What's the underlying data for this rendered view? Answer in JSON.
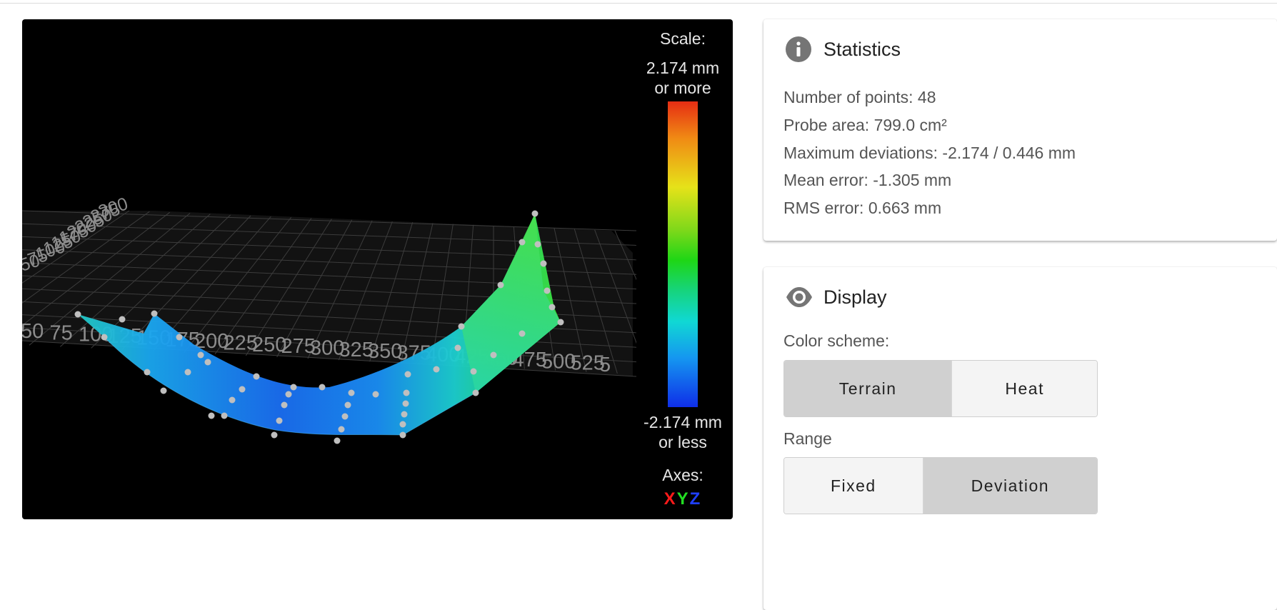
{
  "viewer": {
    "scale_title": "Scale:",
    "scale_max_line1": "2.174 mm",
    "scale_max_line2": "or more",
    "scale_min_line1": "-2.174 mm",
    "scale_min_line2": "or less",
    "axes_title": "Axes:",
    "axis_x": "X",
    "axis_y": "Y",
    "axis_z": "Z",
    "grid_x_labels": [
      "50",
      "75",
      "100",
      "125",
      "150",
      "175",
      "200",
      "225",
      "250",
      "275",
      "300",
      "325",
      "350",
      "375",
      "400",
      "425",
      "450",
      "475",
      "500",
      "525",
      "5"
    ],
    "grid_y_labels": [
      "300",
      "275",
      "250",
      "225",
      "200",
      "175",
      "150",
      "125",
      "100",
      "75",
      "50"
    ],
    "colors": {
      "max": "#e62d13",
      "mid": "#1ed616",
      "min": "#0f2ee8",
      "background": "#000000"
    }
  },
  "statistics": {
    "title": "Statistics",
    "icon": "info-icon",
    "points": "Number of points: 48",
    "area": "Probe area: 799.0 cm²",
    "deviations": "Maximum deviations: -2.174 / 0.446 mm",
    "mean": "Mean error: -1.305 mm",
    "rms": "RMS error: 0.663 mm"
  },
  "display": {
    "title": "Display",
    "icon": "eye-icon",
    "color_scheme_label": "Color scheme:",
    "color_scheme_options": [
      "Terrain",
      "Heat"
    ],
    "color_scheme_selected": "Terrain",
    "range_label": "Range",
    "range_options": [
      "Fixed",
      "Deviation"
    ],
    "range_selected": "Deviation"
  }
}
